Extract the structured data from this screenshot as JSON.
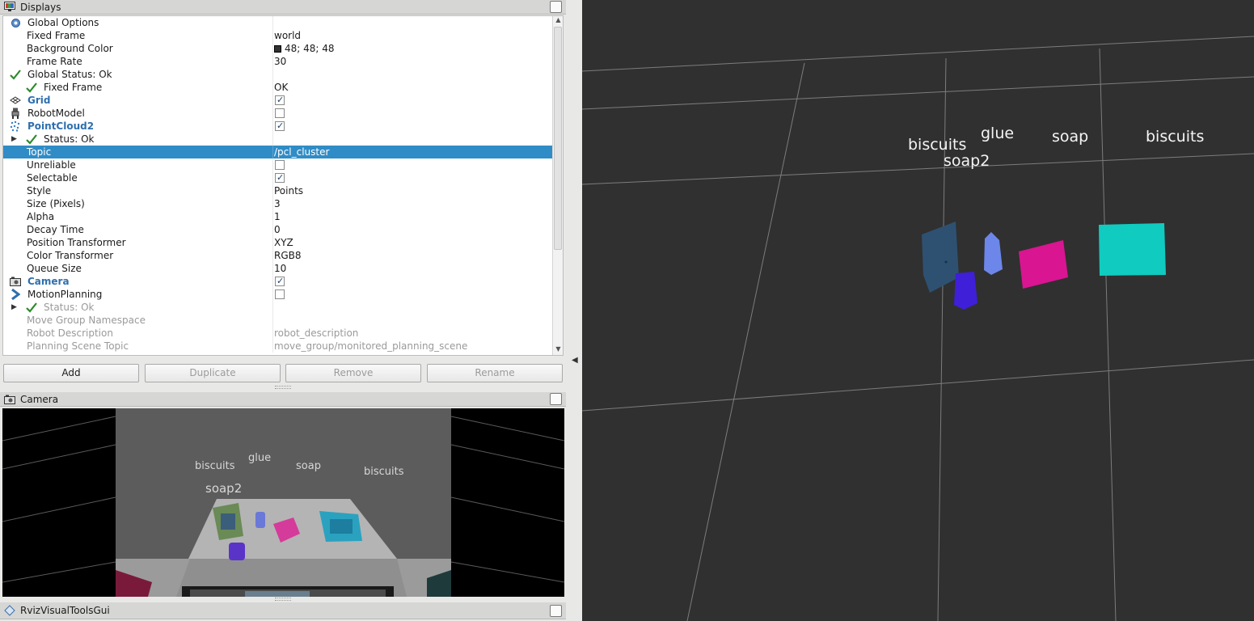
{
  "displays_panel": {
    "title": "Displays"
  },
  "tree": [
    {
      "name": "Global Options",
      "value": "",
      "indent": 0,
      "icon": "gear-icon",
      "type": "group"
    },
    {
      "name": "Fixed Frame",
      "value": "world",
      "indent": 1
    },
    {
      "name": "Background Color",
      "value": "48; 48; 48",
      "indent": 1,
      "swatch": "#303030"
    },
    {
      "name": "Frame Rate",
      "value": "30",
      "indent": 1
    },
    {
      "name": "Global Status: Ok",
      "value": "",
      "indent": 0,
      "icon": "check-icon"
    },
    {
      "name": "Fixed Frame",
      "value": "OK",
      "indent": 1,
      "icon": "check-icon"
    },
    {
      "name": "Grid",
      "value": "",
      "indent": 0,
      "icon": "grid-icon",
      "checkbox": true,
      "bold": true
    },
    {
      "name": "RobotModel",
      "value": "",
      "indent": 0,
      "icon": "robot-icon",
      "checkbox": false
    },
    {
      "name": "PointCloud2",
      "value": "",
      "indent": 0,
      "icon": "pointcloud-icon",
      "checkbox": true,
      "bold": true
    },
    {
      "name": "Status: Ok",
      "value": "",
      "indent": 1,
      "icon": "check-icon",
      "expander": true
    },
    {
      "name": "Topic",
      "value": "/pcl_cluster",
      "indent": 1,
      "selected": true
    },
    {
      "name": "Unreliable",
      "value": "",
      "indent": 1,
      "checkbox": false
    },
    {
      "name": "Selectable",
      "value": "",
      "indent": 1,
      "checkbox": true
    },
    {
      "name": "Style",
      "value": "Points",
      "indent": 1
    },
    {
      "name": "Size (Pixels)",
      "value": "3",
      "indent": 1
    },
    {
      "name": "Alpha",
      "value": "1",
      "indent": 1
    },
    {
      "name": "Decay Time",
      "value": "0",
      "indent": 1
    },
    {
      "name": "Position Transformer",
      "value": "XYZ",
      "indent": 1
    },
    {
      "name": "Color Transformer",
      "value": "RGB8",
      "indent": 1
    },
    {
      "name": "Queue Size",
      "value": "10",
      "indent": 1
    },
    {
      "name": "Camera",
      "value": "",
      "indent": 0,
      "icon": "camera-icon",
      "checkbox": true,
      "bold": true
    },
    {
      "name": "MotionPlanning",
      "value": "",
      "indent": 0,
      "icon": "motion-planning-icon",
      "checkbox": false
    },
    {
      "name": "Status: Ok",
      "value": "",
      "indent": 1,
      "icon": "check-icon",
      "expander": true,
      "dim": true
    },
    {
      "name": "Move Group Namespace",
      "value": "",
      "indent": 1,
      "dim": true
    },
    {
      "name": "Robot Description",
      "value": "robot_description",
      "indent": 1,
      "dim": true
    },
    {
      "name": "Planning Scene Topic",
      "value": "move_group/monitored_planning_scene",
      "indent": 1,
      "dim": true
    }
  ],
  "buttons": {
    "add": "Add",
    "duplicate": "Duplicate",
    "remove": "Remove",
    "rename": "Rename"
  },
  "camera_panel": {
    "title": "Camera"
  },
  "camera_labels": {
    "biscuits_a": "biscuits",
    "glue": "glue",
    "soap": "soap",
    "biscuits_b": "biscuits",
    "soap2": "soap2"
  },
  "rviz_gui_panel": {
    "title": "RvizVisualToolsGui"
  },
  "scene_labels": {
    "biscuits_a": "biscuits",
    "glue": "glue",
    "soap": "soap",
    "biscuits_b": "biscuits",
    "soap2": "soap2"
  },
  "colors": {
    "background": "#303030",
    "selection": "#308cc6",
    "cluster_biscuits_a": "#2e5172",
    "cluster_soap2": "#3f1fd8",
    "cluster_glue": "#6d86e9",
    "cluster_soap": "#d91591",
    "cluster_biscuits_b": "#10cbbf"
  }
}
